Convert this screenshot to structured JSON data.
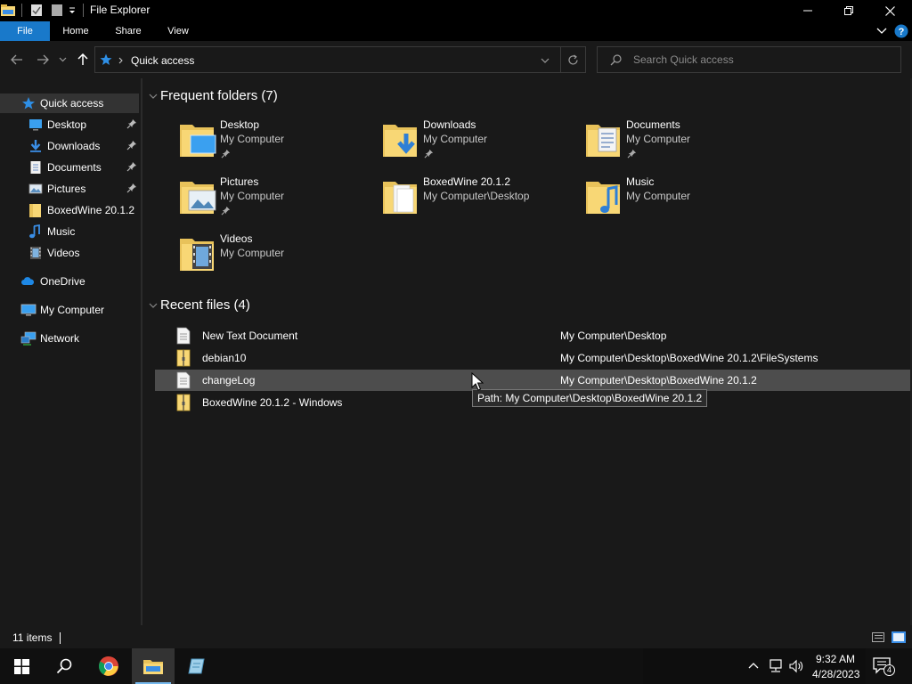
{
  "window": {
    "title": "File Explorer"
  },
  "ribbon": {
    "tabs": [
      "File",
      "Home",
      "Share",
      "View"
    ]
  },
  "address": {
    "path": "Quick access"
  },
  "search": {
    "placeholder": "Search Quick access"
  },
  "nav_pane": {
    "items": [
      {
        "label": "Quick access",
        "icon": "star-icon",
        "selected": true
      },
      {
        "label": "Desktop",
        "icon": "desktop-icon",
        "pinned": true
      },
      {
        "label": "Downloads",
        "icon": "download-arrow-icon",
        "pinned": true
      },
      {
        "label": "Documents",
        "icon": "document-icon",
        "pinned": true
      },
      {
        "label": "Pictures",
        "icon": "pictures-icon",
        "pinned": true
      },
      {
        "label": "BoxedWine 20.1.2",
        "icon": "folder-icon"
      },
      {
        "label": "Music",
        "icon": "music-note-icon"
      },
      {
        "label": "Videos",
        "icon": "film-icon"
      },
      {
        "label": "OneDrive",
        "icon": "cloud-icon"
      },
      {
        "label": "My Computer",
        "icon": "computer-icon"
      },
      {
        "label": "Network",
        "icon": "network-icon"
      }
    ]
  },
  "frequent": {
    "header": "Frequent folders (7)",
    "folders": [
      {
        "name": "Desktop",
        "location": "My Computer",
        "pinned": true
      },
      {
        "name": "Downloads",
        "location": "My Computer",
        "pinned": true
      },
      {
        "name": "Documents",
        "location": "My Computer",
        "pinned": true
      },
      {
        "name": "Pictures",
        "location": "My Computer",
        "pinned": true
      },
      {
        "name": "BoxedWine 20.1.2",
        "location": "My Computer\\Desktop",
        "pinned": false
      },
      {
        "name": "Music",
        "location": "My Computer",
        "pinned": false
      },
      {
        "name": "Videos",
        "location": "My Computer",
        "pinned": false
      }
    ]
  },
  "recent": {
    "header": "Recent files (4)",
    "files": [
      {
        "name": "New Text Document",
        "path": "My Computer\\Desktop",
        "icon": "text-file-icon"
      },
      {
        "name": "debian10",
        "path": "My Computer\\Desktop\\BoxedWine 20.1.2\\FileSystems",
        "icon": "zip-file-icon"
      },
      {
        "name": "changeLog",
        "path": "My Computer\\Desktop\\BoxedWine 20.1.2",
        "icon": "text-file-icon"
      },
      {
        "name": "BoxedWine 20.1.2 - Windows",
        "path": "",
        "icon": "zip-file-icon"
      }
    ]
  },
  "tooltip": {
    "text": "Path: My Computer\\Desktop\\BoxedWine 20.1.2"
  },
  "status": {
    "count": "11 items"
  },
  "taskbar": {
    "time": "9:32 AM",
    "date": "4/28/2023",
    "notifications": "4"
  },
  "colors": {
    "accent": "#1979ca",
    "folder": "#f8d775",
    "background": "#191919"
  }
}
